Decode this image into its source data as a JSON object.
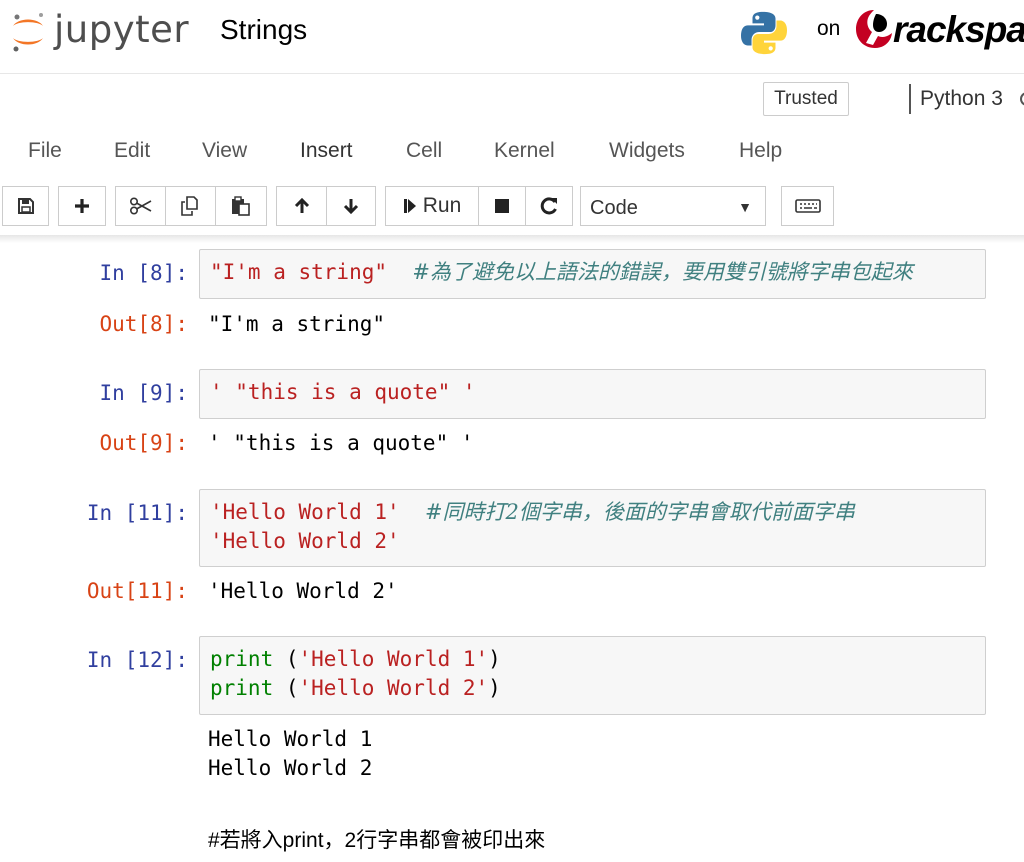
{
  "header": {
    "logo_text": "jupyter",
    "notebook_name": "Strings",
    "on_text": "on",
    "brand_text": "rackspace"
  },
  "menubar": {
    "trusted_label": "Trusted",
    "kernel_name": "Python 3",
    "items": [
      "File",
      "Edit",
      "View",
      "Insert",
      "Cell",
      "Kernel",
      "Widgets",
      "Help"
    ]
  },
  "toolbar": {
    "run_label": "Run",
    "cell_type": "Code",
    "icons": [
      "save-icon",
      "plus-icon",
      "scissors-icon",
      "copy-icon",
      "paste-icon",
      "arrow-up-icon",
      "arrow-down-icon",
      "step-forward-icon",
      "stop-icon",
      "restart-icon",
      "keyboard-icon"
    ]
  },
  "cells": [
    {
      "in_prompt": "In [8]:",
      "lines": [
        [
          {
            "t": "\"I'm a string\"",
            "c": "string"
          },
          {
            "t": "  ",
            "c": "plain"
          },
          {
            "t": "#為了避免以上語法的錯誤，要用雙引號將字串包起來",
            "c": "comment"
          }
        ]
      ],
      "out_prompt": "Out[8]:",
      "output": "\"I'm a string\""
    },
    {
      "in_prompt": "In [9]:",
      "lines": [
        [
          {
            "t": "' \"this is a quote\" '",
            "c": "string"
          }
        ]
      ],
      "out_prompt": "Out[9]:",
      "output": "' \"this is a quote\" '"
    },
    {
      "in_prompt": "In [11]:",
      "lines": [
        [
          {
            "t": "'Hello World 1'",
            "c": "string"
          },
          {
            "t": "  ",
            "c": "plain"
          },
          {
            "t": "#同時打2個字串，後面的字串會取代前面字串",
            "c": "comment"
          }
        ],
        [
          {
            "t": "'Hello World 2'",
            "c": "string"
          }
        ]
      ],
      "out_prompt": "Out[11]:",
      "output": "'Hello World 2'"
    },
    {
      "in_prompt": "In [12]:",
      "lines": [
        [
          {
            "t": "print",
            "c": "builtin"
          },
          {
            "t": " (",
            "c": "plain"
          },
          {
            "t": "'Hello World 1'",
            "c": "string"
          },
          {
            "t": ")",
            "c": "plain"
          }
        ],
        [
          {
            "t": "print",
            "c": "builtin"
          },
          {
            "t": " (",
            "c": "plain"
          },
          {
            "t": "'Hello World 2'",
            "c": "string"
          },
          {
            "t": ")",
            "c": "plain"
          }
        ]
      ],
      "stream_output": [
        "Hello World 1",
        "Hello World 2"
      ]
    }
  ],
  "markdown": {
    "text": "#若將入print，2行字串都會被印出來"
  },
  "colors": {
    "in_prompt": "#303f9f",
    "out_prompt": "#d84315",
    "string": "#ba2121",
    "comment": "#408080",
    "builtin": "#008000",
    "python_blue": "#3572a5",
    "python_yellow": "#ffd43b",
    "rackspace_red": "#c40022",
    "jupyter_orange": "#f37626"
  }
}
